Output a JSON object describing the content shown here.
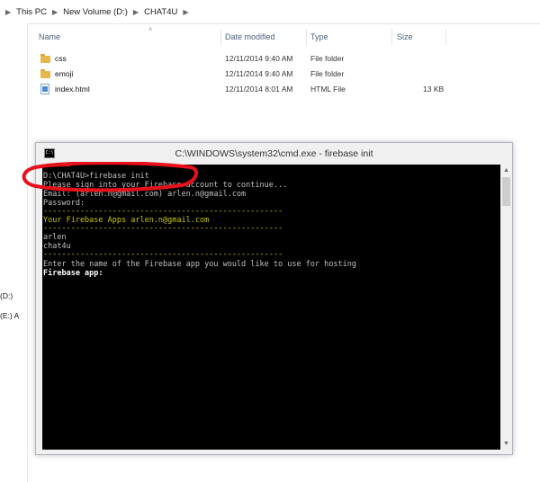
{
  "address_bar": {
    "crumbs": [
      "This PC",
      "New Volume (D:)",
      "CHAT4U"
    ]
  },
  "left_pane": {
    "items": [
      "(D:)",
      "(E:) A"
    ]
  },
  "columns": {
    "name": "Name",
    "date_modified": "Date modified",
    "type": "Type",
    "size": "Size"
  },
  "files": [
    {
      "name": "css",
      "date": "12/11/2014 9:40 AM",
      "type": "File folder",
      "size": "",
      "icon": "folder-icon"
    },
    {
      "name": "emoji",
      "date": "12/11/2014 9:40 AM",
      "type": "File folder",
      "size": "",
      "icon": "folder-icon"
    },
    {
      "name": "index.html",
      "date": "12/11/2014 8:01 AM",
      "type": "HTML File",
      "size": "13 KB",
      "icon": "html-file-icon"
    }
  ],
  "cmd_window": {
    "title": "C:\\WINDOWS\\system32\\cmd.exe - firebase  init",
    "icon_label": "C:\\",
    "lines": [
      "D:\\CHAT4U>firebase init",
      "Please sign into your Firebase account to continue...",
      "Email: (arlen.n@gmail.com) arlen.n@gmail.com",
      "Password:",
      "----------------------------------------------------",
      "Your Firebase Apps arlen.n@gmail.com",
      "----------------------------------------------------",
      "arlen",
      "chat4u",
      "----------------------------------------------------",
      "Enter the name of the Firebase app you would like to use for hosting",
      "Firebase app:"
    ]
  },
  "colors": {
    "console_bg": "#000000",
    "console_text": "#c0c0c0",
    "console_highlight": "#c8c800",
    "annotation": "#e8101a"
  }
}
